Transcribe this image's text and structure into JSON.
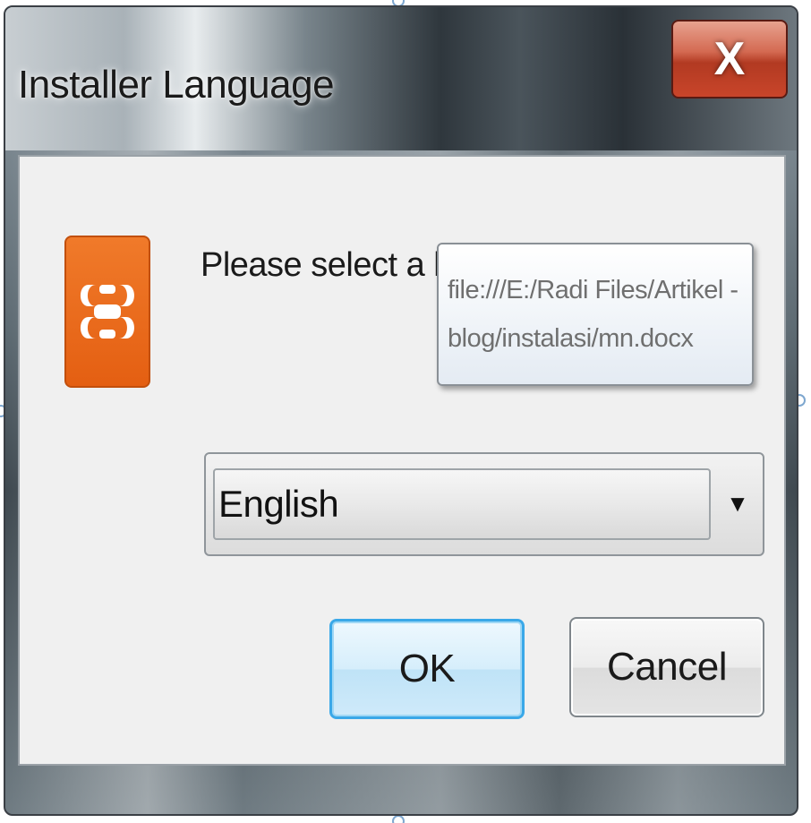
{
  "window": {
    "title": "Installer Language",
    "close_glyph": "X"
  },
  "dialog": {
    "prompt": "Please select a lan",
    "tooltip_line1": "file:///E:/Radi Files/Artikel -",
    "tooltip_line2": "blog/instalasi/mn.docx",
    "language_select": {
      "selected": "English",
      "arrow_icon": "dropdown-arrow-icon"
    },
    "buttons": {
      "ok": "OK",
      "cancel": "Cancel"
    },
    "app_icon": "xampp-logo-icon"
  },
  "colors": {
    "icon_orange": "#e45f12",
    "close_red": "#c9452a",
    "ok_focus": "#3aa8e8"
  }
}
